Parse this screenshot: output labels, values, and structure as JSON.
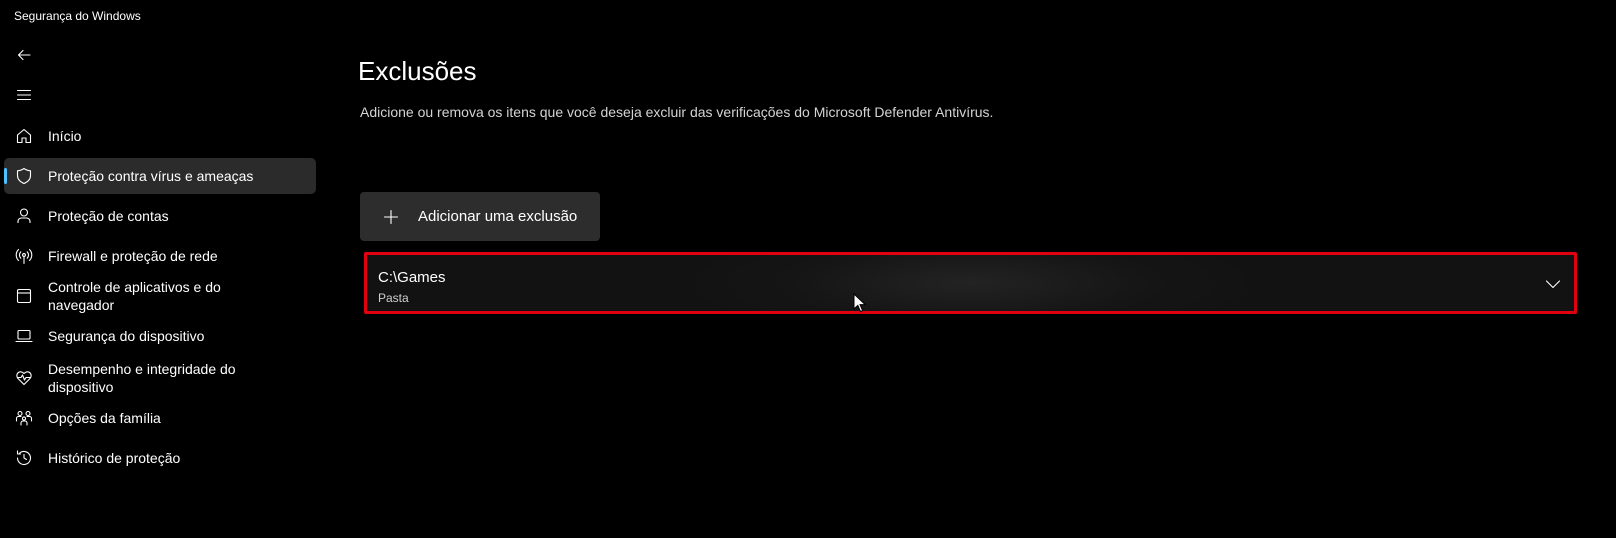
{
  "window": {
    "title": "Segurança do Windows"
  },
  "sidebar": {
    "items": [
      {
        "label": "Início",
        "icon": "home-icon"
      },
      {
        "label": "Proteção contra vírus e ameaças",
        "icon": "shield-icon",
        "selected": true
      },
      {
        "label": "Proteção de contas",
        "icon": "person-icon"
      },
      {
        "label": "Firewall e proteção de rede",
        "icon": "antenna-icon"
      },
      {
        "label": "Controle de aplicativos e do navegador",
        "icon": "browser-window-icon"
      },
      {
        "label": "Segurança do dispositivo",
        "icon": "laptop-icon"
      },
      {
        "label": "Desempenho e integridade do dispositivo",
        "icon": "heart-pulse-icon"
      },
      {
        "label": "Opções da família",
        "icon": "family-icon"
      },
      {
        "label": "Histórico de proteção",
        "icon": "history-icon"
      }
    ]
  },
  "main": {
    "title": "Exclusões",
    "description": "Adicione ou remova os itens que você deseja excluir das verificações do Microsoft Defender Antivírus.",
    "add_button_label": "Adicionar uma exclusão",
    "exclusions": [
      {
        "path": "C:\\Games",
        "type": "Pasta"
      }
    ]
  },
  "colors": {
    "background": "#000000",
    "selected_item": "#2b2b2b",
    "accent": "#4cc2ff",
    "highlight_border": "#e0000f",
    "button": "#2d2d2d"
  }
}
